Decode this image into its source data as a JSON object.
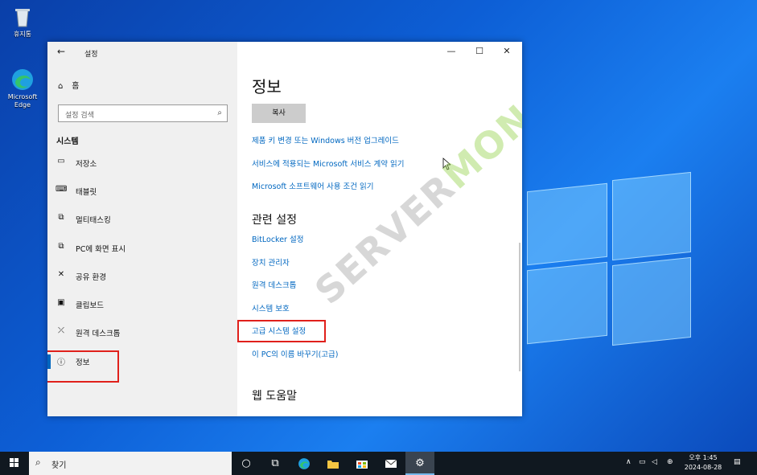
{
  "desktop": {
    "icons": [
      {
        "label": "휴지통",
        "icon": "recycle-bin-icon"
      },
      {
        "label": "Microsoft Edge",
        "icon": "edge-icon"
      }
    ]
  },
  "window": {
    "title": "설정",
    "back_icon": "←",
    "controls": {
      "minimize": "—",
      "maximize": "☐",
      "close": "✕"
    }
  },
  "sidebar": {
    "home_label": "홈",
    "search_placeholder": "설정 검색",
    "section_title": "시스템",
    "items": [
      {
        "label": "저장소",
        "icon": "storage-icon",
        "glyph": "▭"
      },
      {
        "label": "태블릿",
        "icon": "tablet-icon",
        "glyph": "⌨"
      },
      {
        "label": "멀티태스킹",
        "icon": "multitasking-icon",
        "glyph": "⧉"
      },
      {
        "label": "PC에 화면 표시",
        "icon": "project-icon",
        "glyph": "⧉"
      },
      {
        "label": "공유 환경",
        "icon": "shared-experiences-icon",
        "glyph": "✕"
      },
      {
        "label": "클립보드",
        "icon": "clipboard-icon",
        "glyph": "📋"
      },
      {
        "label": "원격 데스크톱",
        "icon": "remote-desktop-icon",
        "glyph": "⤫"
      },
      {
        "label": "정보",
        "icon": "info-icon",
        "glyph": "ⓘ",
        "active": true
      }
    ]
  },
  "content": {
    "title": "정보",
    "copy_button": "복사",
    "links_top": [
      "제품 키 변경 또는 Windows 버전 업그레이드",
      "서비스에 적용되는 Microsoft 서비스 계약 읽기",
      "Microsoft 소프트웨어 사용 조건 읽기"
    ],
    "related_title": "관련 설정",
    "related_links": [
      "BitLocker 설정",
      "장치 관리자",
      "원격 데스크톱",
      "시스템 보호",
      "고급 시스템 설정",
      "이 PC의 이름 바꾸기(고급)"
    ],
    "help_title": "웹 도움말"
  },
  "watermark": {
    "part1": "SERVER",
    "part2": "MON"
  },
  "taskbar": {
    "search_placeholder": "찾기",
    "tray": {
      "ime": "⊕",
      "time": "오후 1:45",
      "date": "2024-08-28"
    }
  },
  "colors": {
    "accent": "#0067c0",
    "highlight": "#e0201b",
    "taskbar": "#101820"
  }
}
